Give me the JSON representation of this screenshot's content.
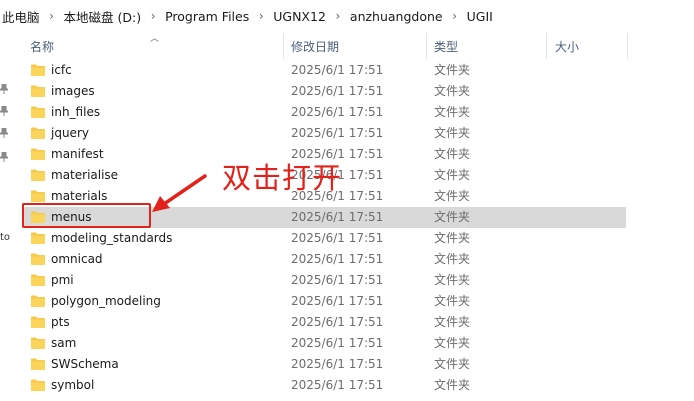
{
  "breadcrumb": [
    "此电脑",
    "本地磁盘 (D:)",
    "Program Files",
    "UGNX12",
    "anzhuangdone",
    "UGII"
  ],
  "columns": {
    "name": "名称",
    "date": "修改日期",
    "type": "类型",
    "size": "大小"
  },
  "folders": [
    {
      "name": "icfc",
      "date": "2025/6/1 17:51",
      "type": "文件夹"
    },
    {
      "name": "images",
      "date": "2025/6/1 17:51",
      "type": "文件夹"
    },
    {
      "name": "inh_files",
      "date": "2025/6/1 17:51",
      "type": "文件夹"
    },
    {
      "name": "jquery",
      "date": "2025/6/1 17:51",
      "type": "文件夹"
    },
    {
      "name": "manifest",
      "date": "2025/6/1 17:51",
      "type": "文件夹"
    },
    {
      "name": "materialise",
      "date": "2025/6/1 17:51",
      "type": "文件夹"
    },
    {
      "name": "materials",
      "date": "2025/6/1 17:51",
      "type": "文件夹"
    },
    {
      "name": "menus",
      "date": "2025/6/1 17:51",
      "type": "文件夹",
      "selected": true
    },
    {
      "name": "modeling_standards",
      "date": "2025/6/1 17:51",
      "type": "文件夹"
    },
    {
      "name": "omnicad",
      "date": "2025/6/1 17:51",
      "type": "文件夹"
    },
    {
      "name": "pmi",
      "date": "2025/6/1 17:51",
      "type": "文件夹"
    },
    {
      "name": "polygon_modeling",
      "date": "2025/6/1 17:51",
      "type": "文件夹"
    },
    {
      "name": "pts",
      "date": "2025/6/1 17:51",
      "type": "文件夹"
    },
    {
      "name": "sam",
      "date": "2025/6/1 17:51",
      "type": "文件夹"
    },
    {
      "name": "SWSchema",
      "date": "2025/6/1 17:51",
      "type": "文件夹"
    },
    {
      "name": "symbol",
      "date": "2025/6/1 17:51",
      "type": "文件夹"
    }
  ],
  "nav_cut_label": "to",
  "annotation": {
    "text": "双击打开",
    "color": "#e3221c"
  },
  "colors": {
    "folder": "#f7c94a",
    "selected_row": "#d9d9d9",
    "header_text": "#4c607a"
  },
  "icons": {
    "folder": "folder-icon",
    "pin": "pin-icon",
    "sort": "sort-up-icon",
    "separator": "chevron-right-icon"
  }
}
